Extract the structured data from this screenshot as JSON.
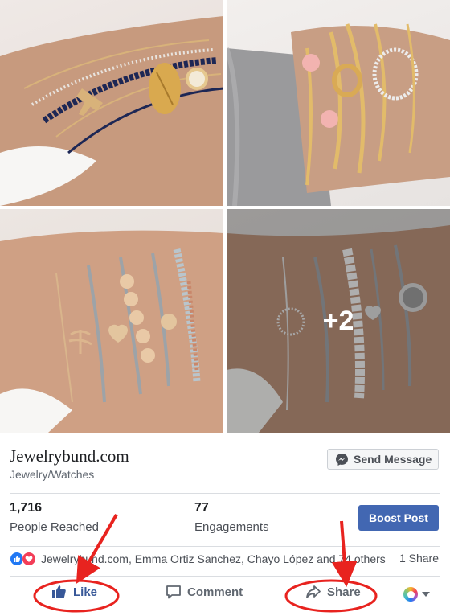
{
  "photos": {
    "more_count": "+2"
  },
  "page": {
    "name": "Jewelrybund.com",
    "category": "Jewelry/Watches",
    "send_message_label": "Send Message"
  },
  "stats": {
    "reached_value": "1,716",
    "reached_label": "People Reached",
    "engagements_value": "77",
    "engagements_label": "Engagements",
    "boost_label": "Boost Post"
  },
  "reactions": {
    "icons": [
      "like-icon",
      "love-icon"
    ],
    "names_text": "Jewelrybund.com, Emma Ortiz Sanchez, Chayo López and 74 others",
    "share_count": "1 Share"
  },
  "actions": {
    "like_label": "Like",
    "comment_label": "Comment",
    "share_label": "Share"
  },
  "colors": {
    "facebook_blue": "#4267b2",
    "like_active": "#385898",
    "annotation_red": "#e8231f"
  }
}
